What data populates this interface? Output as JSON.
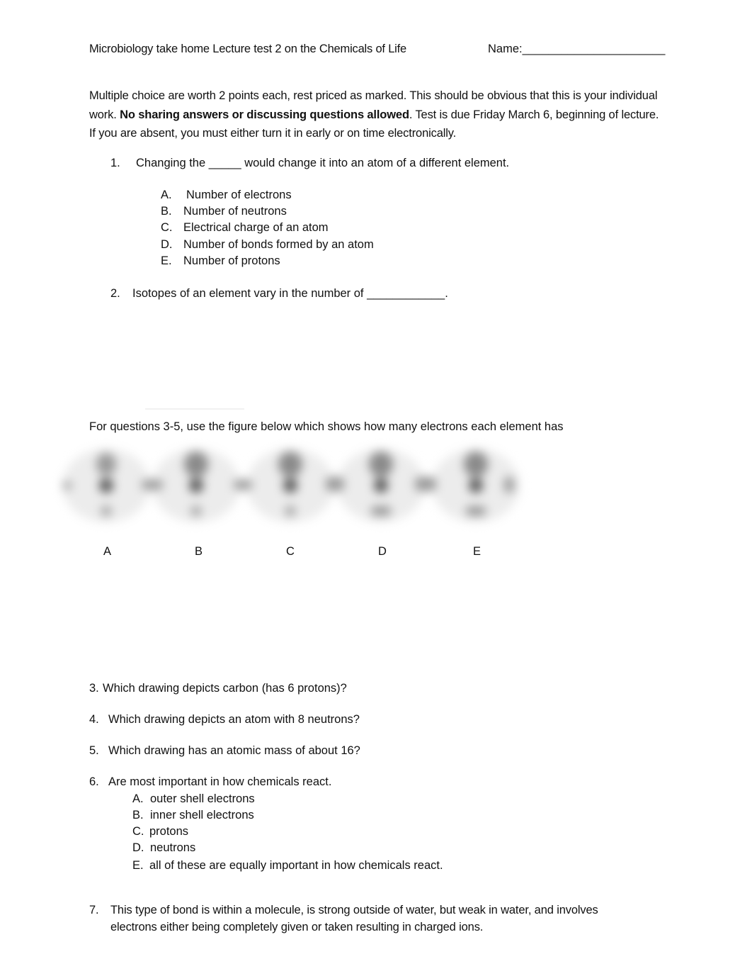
{
  "header": {
    "title": "Microbiology take home Lecture test 2 on the Chemicals of Life",
    "name_label": "Name:______________________"
  },
  "instructions": {
    "part1": "Multiple choice are worth 2 points each, rest priced as marked. This should be obvious that this is your individual work. ",
    "bold": "No sharing answers or discussing questions allowed",
    "part2": ". Test is due Friday March 6, beginning of lecture. If you are absent, you must either turn it in early or on time electronically."
  },
  "questions": [
    {
      "number": "1.",
      "text": "Changing the _____ would change it into an atom of a different element.",
      "options": [
        {
          "letter": "A.",
          "text": "Number of electrons"
        },
        {
          "letter": "B.",
          "text": "Number of neutrons"
        },
        {
          "letter": "C.",
          "text": "Electrical charge of an atom"
        },
        {
          "letter": "D.",
          "text": "Number of bonds formed by an atom"
        },
        {
          "letter": "E.",
          "text": "Number of protons"
        }
      ]
    },
    {
      "number": "2.",
      "text": "Isotopes of an element vary in the number of ____________."
    },
    {
      "number": "3.",
      "text": "Which drawing depicts carbon (has 6 protons)?"
    },
    {
      "number": "4.",
      "text": "Which drawing depicts an atom with 8 neutrons?"
    },
    {
      "number": "5.",
      "text": "Which drawing has an atomic mass of about 16?"
    },
    {
      "number": "6.",
      "text": "Are most important in how chemicals react.",
      "options": [
        {
          "letter": "A.",
          "text": "outer shell electrons"
        },
        {
          "letter": "B.",
          "text": "inner shell electrons"
        },
        {
          "letter": "C.",
          "text": "protons"
        },
        {
          "letter": "D.",
          "text": "neutrons"
        },
        {
          "letter": "E.",
          "text": "all of these are equally important in how chemicals react."
        }
      ]
    },
    {
      "number": "7.",
      "line1": "This type of bond is within a molecule, is strong outside of water, but weak in water, and involves",
      "line2": "electrons either being completely given or taken resulting in charged ions."
    }
  ],
  "figure": {
    "intro": "For questions 3-5, use the figure below which shows how many electrons each element has",
    "labels": [
      "A",
      "B",
      "C",
      "D",
      "E"
    ]
  }
}
